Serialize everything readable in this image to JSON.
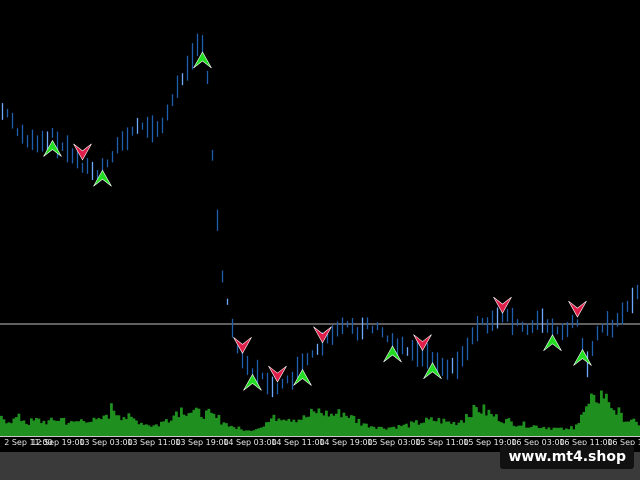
{
  "watermark": "www.mt4.shop",
  "colors": {
    "background": "#000000",
    "price": "#1e5fae",
    "price_highlight": "#6fa8ff",
    "volume": "#1f8f1f",
    "buy_arrow": "#22dd22",
    "sell_arrow": "#e0204a",
    "level_line": "#bfbfbf"
  },
  "x_axis": {
    "ticks": [
      "2 Sep 11:00",
      "12 Sep 19:00",
      "13 Sep 03:00",
      "13 Sep 11:00",
      "13 Sep 19:00",
      "14 Sep 03:00",
      "14 Sep 11:00",
      "14 Sep 19:00",
      "15 Sep 03:00",
      "15 Sep 11:00",
      "15 Sep 19:00",
      "16 Sep 03:00",
      "16 Sep 11:00",
      "16 Sep 19:00"
    ]
  },
  "chart_data": {
    "type": "line",
    "series": [
      {
        "values": [
          0.8,
          0.78,
          0.74,
          0.72,
          0.7,
          0.71,
          0.73,
          0.7,
          0.68,
          0.66,
          0.64,
          0.62,
          0.65,
          0.68,
          0.71,
          0.73,
          0.75,
          0.76,
          0.74,
          0.77,
          0.82,
          0.88,
          0.94,
          0.99,
          0.97,
          0.6,
          0.34,
          0.2,
          0.12,
          0.08,
          0.06,
          0.04,
          0.03,
          0.02,
          0.04,
          0.07,
          0.1,
          0.12,
          0.14,
          0.16,
          0.19,
          0.21,
          0.18,
          0.2,
          0.19,
          0.17,
          0.15,
          0.14,
          0.13,
          0.12,
          0.11,
          0.1,
          0.09,
          0.07,
          0.09,
          0.14,
          0.19,
          0.21,
          0.2,
          0.22,
          0.21,
          0.2,
          0.19,
          0.21,
          0.2,
          0.18,
          0.17,
          0.19,
          0.21,
          0.07,
          0.15,
          0.2,
          0.18,
          0.22,
          0.26,
          0.3
        ]
      }
    ],
    "level_line": 0.2,
    "volume": [
      0.35,
      0.3,
      0.38,
      0.26,
      0.32,
      0.28,
      0.3,
      0.36,
      0.24,
      0.3,
      0.34,
      0.28,
      0.36,
      0.55,
      0.42,
      0.35,
      0.3,
      0.24,
      0.2,
      0.28,
      0.4,
      0.55,
      0.5,
      0.46,
      0.45,
      0.38,
      0.3,
      0.2,
      0.14,
      0.1,
      0.16,
      0.24,
      0.36,
      0.4,
      0.36,
      0.34,
      0.38,
      0.5,
      0.46,
      0.42,
      0.48,
      0.4,
      0.3,
      0.22,
      0.2,
      0.16,
      0.18,
      0.2,
      0.22,
      0.26,
      0.3,
      0.32,
      0.3,
      0.26,
      0.28,
      0.45,
      0.55,
      0.5,
      0.4,
      0.34,
      0.28,
      0.24,
      0.22,
      0.2,
      0.18,
      0.16,
      0.14,
      0.12,
      0.3,
      0.55,
      0.75,
      0.85,
      0.6,
      0.4,
      0.3,
      0.25
    ],
    "signals": [
      {
        "type": "buy",
        "at": 10
      },
      {
        "type": "sell",
        "at": 16
      },
      {
        "type": "buy",
        "at": 20
      },
      {
        "type": "buy",
        "at": 40
      },
      {
        "type": "sell",
        "at": 48
      },
      {
        "type": "buy",
        "at": 50
      },
      {
        "type": "sell",
        "at": 55
      },
      {
        "type": "buy",
        "at": 60
      },
      {
        "type": "sell",
        "at": 64
      },
      {
        "type": "buy",
        "at": 78
      },
      {
        "type": "sell",
        "at": 84
      },
      {
        "type": "buy",
        "at": 86
      },
      {
        "type": "sell",
        "at": 100
      },
      {
        "type": "buy",
        "at": 110
      },
      {
        "type": "sell",
        "at": 115
      },
      {
        "type": "buy",
        "at": 116
      }
    ]
  }
}
